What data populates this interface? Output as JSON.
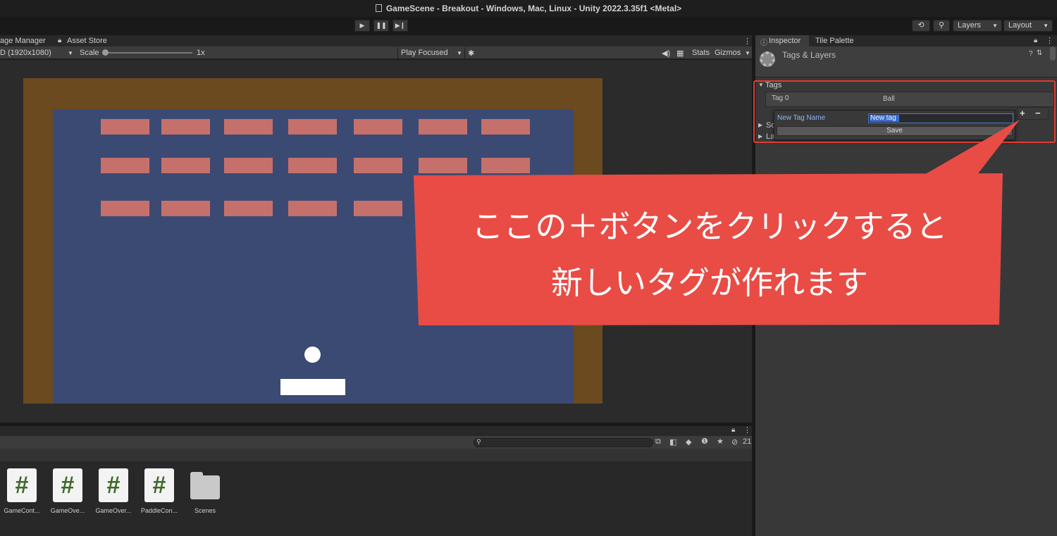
{
  "window": {
    "title": "GameScene - Breakout - Windows, Mac, Linux - Unity 2022.3.35f1 <Metal>"
  },
  "toolbar": {
    "play_icon": "play-icon",
    "pause_icon": "pause-icon",
    "step_icon": "step-icon",
    "layers_label": "Layers",
    "layout_label": "Layout"
  },
  "game_tabs": {
    "package_manager": "age Manager",
    "asset_store": "Asset Store"
  },
  "game_ctrl": {
    "resolution": "D (1920x1080)",
    "scale_label": "Scale",
    "scale_value": "1x",
    "play_mode": "Play Focused",
    "stats": "Stats",
    "gizmos": "Gizmos"
  },
  "project": {
    "hidden_count": "21",
    "assets": [
      {
        "label": "GameCont...",
        "type": "script",
        "glyph": "#"
      },
      {
        "label": "GameOve...",
        "type": "script",
        "glyph": "#"
      },
      {
        "label": "GameOver...",
        "type": "script",
        "glyph": "#"
      },
      {
        "label": "PaddleCon...",
        "type": "script",
        "glyph": "#"
      },
      {
        "label": "Scenes",
        "type": "folder"
      }
    ]
  },
  "inspector": {
    "tab_inspector": "Inspector",
    "tab_tile_palette": "Tile Palette",
    "header_title": "Tags & Layers",
    "tags_section": "Tags",
    "tag0_label": "Tag 0",
    "tag0_value": "Ball",
    "sorting_layers_partial": "So",
    "layers_partial": "La",
    "popup": {
      "field_label": "New Tag Name",
      "field_value": "New tag",
      "save_label": "Save"
    },
    "plus_label": "+",
    "minus_label": "−"
  },
  "callout": {
    "line1": "ここの＋ボタンをクリックすると",
    "line2": "新しいタグが作れます",
    "color": "#e84c45"
  },
  "colors": {
    "game_border": "#6b4a1f",
    "game_background": "#3b4a72",
    "brick": "#c6706c",
    "highlight_red": "#e23b33"
  }
}
